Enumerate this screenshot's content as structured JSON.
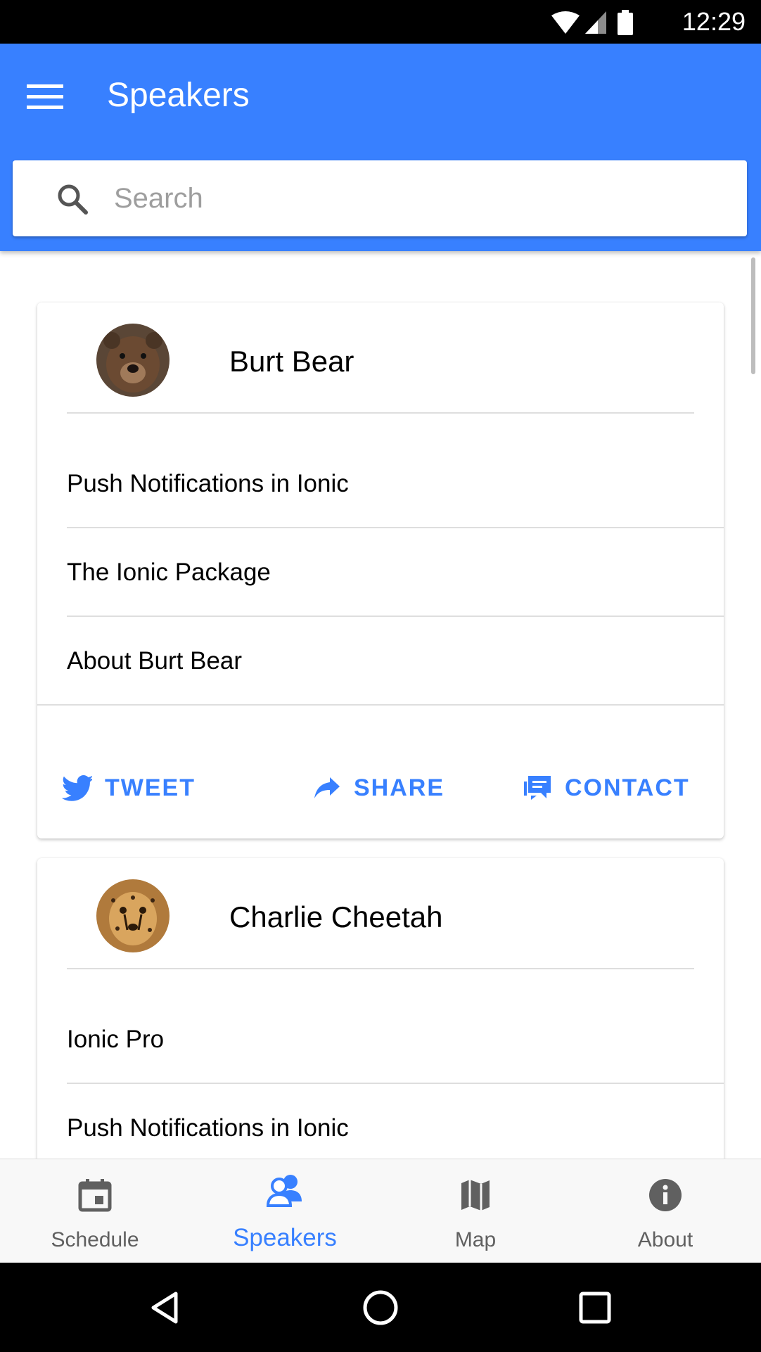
{
  "status_bar": {
    "time": "12:29",
    "icons": [
      "wifi-icon",
      "signal-icon",
      "battery-icon"
    ]
  },
  "toolbar": {
    "title": "Speakers",
    "menu_icon": "menu-icon"
  },
  "search": {
    "placeholder": "Search",
    "value": "",
    "icon": "search-icon"
  },
  "speakers": [
    {
      "name": "Burt Bear",
      "avatar": "bear-photo",
      "sessions": [
        "Push Notifications in Ionic",
        "The Ionic Package"
      ],
      "about": "About Burt Bear",
      "actions": {
        "tweet": "TWEET",
        "share": "SHARE",
        "contact": "CONTACT"
      }
    },
    {
      "name": "Charlie Cheetah",
      "avatar": "cheetah-photo",
      "sessions": [
        "Ionic Pro",
        "Push Notifications in Ionic"
      ]
    }
  ],
  "tabs": [
    {
      "label": "Schedule",
      "icon": "calendar-icon",
      "active": false
    },
    {
      "label": "Speakers",
      "icon": "people-icon",
      "active": true
    },
    {
      "label": "Map",
      "icon": "map-icon",
      "active": false
    },
    {
      "label": "About",
      "icon": "info-icon",
      "active": false
    }
  ],
  "navigation": [
    "back-icon",
    "home-icon",
    "recents-icon"
  ],
  "colors": {
    "primary": "#3880ff",
    "status_bar": "#000000",
    "tab_inactive": "#606060"
  }
}
